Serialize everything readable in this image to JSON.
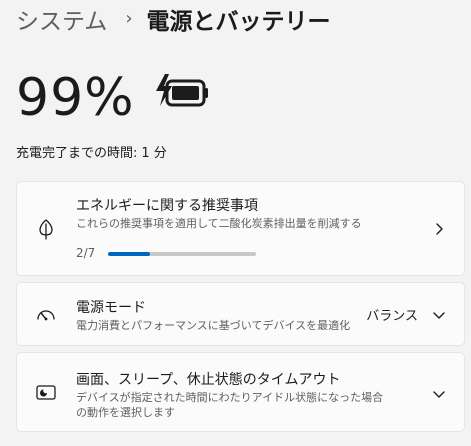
{
  "breadcrumb": {
    "parent": "システム",
    "current": "電源とバッテリー"
  },
  "battery": {
    "percent_label": "99%",
    "charge_label": "充電完了までの時間:",
    "charge_value": "1 分"
  },
  "energy_card": {
    "title": "エネルギーに関する推奨事項",
    "subtitle": "これらの推奨事項を適用して二酸化炭素排出量を削減する",
    "progress_label": "2/7",
    "progress_fraction": 0.2857,
    "accent_color": "#0067c0"
  },
  "power_mode_card": {
    "title": "電源モード",
    "subtitle": "電力消費とパフォーマンスに基づいてデバイスを最適化",
    "selected_value": "バランス"
  },
  "screen_card": {
    "title": "画面、スリープ、休止状態のタイムアウト",
    "subtitle": "デバイスが指定された時間にわたりアイドル状態になった場合の動作を選択します"
  }
}
